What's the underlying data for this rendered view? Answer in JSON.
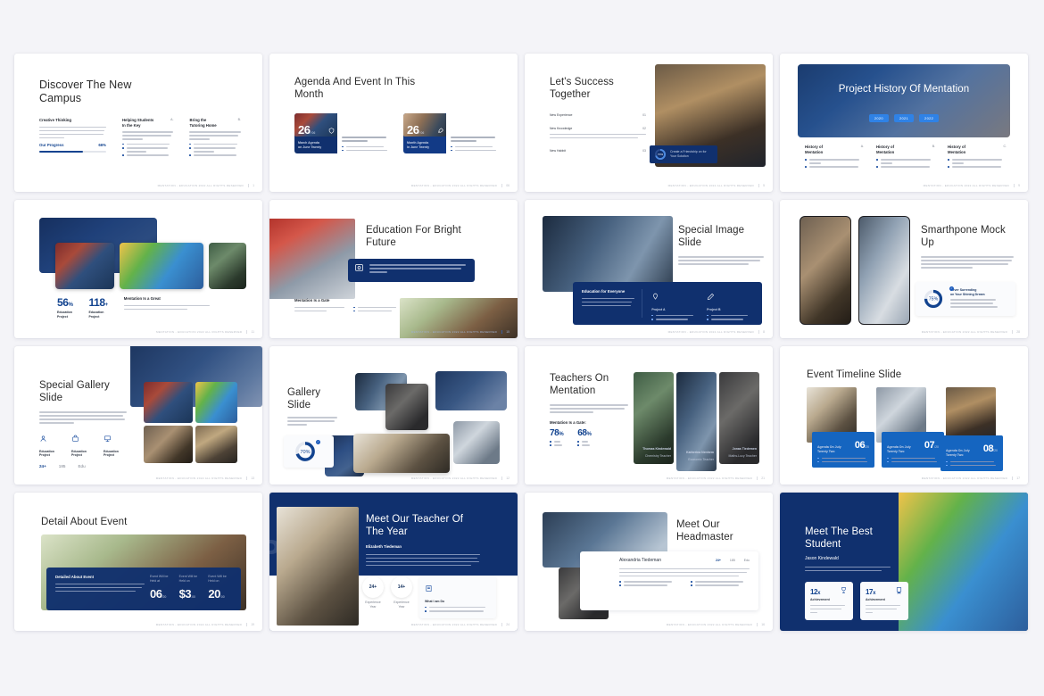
{
  "background_color": "#f4f4f8",
  "accent_navy": "#10306e",
  "accent_blue": "#1565c0",
  "footer": {
    "text": "MENTATION - EDUCATION 2022 ALL RIGHTS RESERVED"
  },
  "slides": [
    {
      "id": "discover-the-new-campus",
      "page": "1",
      "title": "Discover The New Campus",
      "col1_heading": "Creative Thinking",
      "col1_body": "Busey ipsu holoen sit amet, dolor hask you ornaweif? Home Here you doloreit your Noeldar? Are you fine? Because if you howen is wahcerta come out juan.",
      "progress_label": "Our Progress",
      "progress_value": "66%",
      "progress_pct": 66,
      "col2_heading": "Helping Students\nIn the Key",
      "col2_marker": "A.",
      "col2_body": "Busey ipsu holoen sit amet, have you ornaweif? have you doloreit?",
      "col2_bullets": [
        "I choise hysed dolan among the",
        "By the bulleing dolus bulun dolor",
        "Ansay ipsum dolor inumas"
      ],
      "col3_heading": "Bring the\nTutoring Home",
      "col3_marker": "B.",
      "col3_body": "Busey ipsu holoen sit amet, have you ornaweif? have you doloreit?",
      "col3_bullets": [
        "I choise hysed dolam among the",
        "By the holeing uilhai ipsum dolor",
        "Busey ipsum dolor sit amet"
      ]
    },
    {
      "id": "agenda-and-event-in-this-month",
      "page": "06",
      "title": "Agenda And Event In This Month",
      "cards": [
        {
          "day": "26",
          "month": "/ 06",
          "icon": "shield-icon",
          "caption": "March Agenda\non June Twenty",
          "body": "Busey ipsu lorem sit amet. The magic lorban.",
          "bullets": [
            "Busey ipsum dolor sit",
            "Indian is a maxim isocaps"
          ]
        },
        {
          "day": "26",
          "month": "/ 06",
          "icon": "rocket-icon",
          "caption": "Month Agenda\nin June Twenty",
          "body": "Busey ipsum dolor sit amet. The magic lorban.",
          "bullets": [
            "Busey ipsum dolor sit",
            "Indian is a myderica.ups"
          ]
        }
      ]
    },
    {
      "id": "lets-success-together",
      "page": "5",
      "title": "Let's Success Together",
      "items": [
        {
          "label": "New Experience",
          "num": "01",
          "body": ""
        },
        {
          "label": "New Knowledge",
          "num": "02",
          "body": "Busey ipsum dolor sit amet, have you ornaweif? busey ipsum ter magic lorban is a mysterious spiritual fluent and amet."
        },
        {
          "label": "New Habbit",
          "num": "03",
          "body": ""
        }
      ],
      "overlay_title": "Create a Friendship on for\nYour Solution",
      "overlay_donut": "70%"
    },
    {
      "id": "project-history-of-mentation",
      "page": "9",
      "title": "Project History Of Mentation",
      "years": [
        "2020",
        "2021",
        "2022"
      ],
      "columns": [
        {
          "heading": "History of\nMentation",
          "marker": "A.",
          "bullets": [
            "Busey ipsum dolor sit amet, busey 001",
            "ur holdeif? Bismeyu dif distacif you r"
          ]
        },
        {
          "heading": "History of\nMentation",
          "marker": "B.",
          "bullets": [
            "Busey ipsum dolor sit amet, busey 001",
            "ur holdeif? Home you dif bonlis lurlur"
          ]
        },
        {
          "heading": "History of\nMentation",
          "marker": "C.",
          "bullets": [
            "Busey ipsum dolor sit amet, i busey 001",
            "ainholdeif? Have your dif detaci ipsup"
          ]
        }
      ]
    },
    {
      "id": "statistic-gallery-slide",
      "page": "11",
      "stats": [
        {
          "value": "56",
          "unit": "%",
          "label": "Education\nProject"
        },
        {
          "value": "118",
          "unit": "+",
          "label": "Education\nProject"
        }
      ],
      "heading": "Mentation Is a Great",
      "body": "Busey ipsum dolor sit amet. The magic lorban is a going to Cathedral storytexical spiritual for to soul"
    },
    {
      "id": "education-for-bright-future",
      "page": "15",
      "title": "Education For Bright Future",
      "banner_icon": "certificate-icon",
      "banner_body": "Busey ipsum dolor sit amet, have than you ushojeif? some have you doloreit your hhdolen? Are you fine? Because of you howen is a will",
      "heading": "Mentation Is a Gate",
      "body": "Busey ipsum dolor sit amet. Have you ornaleif? Busey ipsum",
      "bullets": [
        "Busey ipsum dolor sit",
        "urholdeif? have you"
      ]
    },
    {
      "id": "special-image-slide",
      "page": "8",
      "title": "Special Image Slide",
      "body": "Busey ipsum dolor sit amet. The magic lorban is mysterious spiritual fluent and am ingoing to Cathedral Rock, and that's the on-tour",
      "panel_heading": "Education for Everyone",
      "panel_body": "Busey ipsum dolor sit amet. The magic lorban is a mysterious spiritual fluent and, and am ingoing to Cathedral Rock, and that's the",
      "panel_cols": [
        {
          "icon": "pin-icon",
          "heading": "Project A",
          "bullets": [
            "Busey ipsum dolor sit",
            "urholdeif? Have you"
          ]
        },
        {
          "icon": "pencil-icon",
          "heading": "Project B",
          "bullets": [
            "Busey ipsum dolor sit",
            "urholdeif? have you"
          ]
        }
      ]
    },
    {
      "id": "smartphone-mock-up",
      "page": "28",
      "title": "Smarthpone Mock Up",
      "body": "Busey ipsum dolor sit amet. The magic dolor lorban is a mysterious spiritual fluent amu and am to prolgase micro Cathedral must, and spiritual flurios bonlist seed sid",
      "card_heading": "Never Surrending\non Your Shining Dream",
      "card_bullets": [
        "Busey ipsum solitin sit ipsum",
        "Indion is a mysterious sipci",
        "Busey ipsum ladoi sit inlins"
      ],
      "donut": "75%"
    },
    {
      "id": "special-gallery-slide",
      "page": "13",
      "title": "Special Gallery Slide",
      "body": "Busey ipsum dolor sit amet. The magic lorban is a mysterious spiritual for to tutorial and am ingoing to Cathedral Rock, and am prohealme amant, and am ingoing to damestrial.",
      "features": [
        {
          "icon": "user-icon",
          "label": "Education\nProject"
        },
        {
          "icon": "bag-icon",
          "label": "Education\nProject"
        },
        {
          "icon": "board-icon",
          "label": "Education\nProject"
        }
      ],
      "metrics": [
        "24+",
        "185",
        "Edu"
      ]
    },
    {
      "id": "gallery-slide",
      "page": "12",
      "title": "Gallery Slide",
      "body": "Busey ipsum dolor sit amet. The magical lorban is a mysterious spiritual.",
      "donut": "70%"
    },
    {
      "id": "teachers-on-mentation",
      "page": "21",
      "title": "Teachers On Mentation",
      "body": "Busey ipsum dolor sit amet. The magic lorban is a mysterious spiritual fluent, and am ingoing to Cathedral Rock, and",
      "heading": "Mentation Is a Gate:",
      "stats": [
        {
          "value": "78",
          "unit": "%",
          "bullets": [
            "Busey ipsum",
            "Urhaldeifipsum"
          ]
        },
        {
          "value": "68",
          "unit": "%",
          "bullets": [
            "Busey ipsum",
            "Urhaldeifipsum"
          ]
        }
      ],
      "teachers": [
        {
          "name": "Thomas Kindewald",
          "role": "Chemistry Teacher"
        },
        {
          "name": "Katherina Nenhem",
          "role": "Economic Teacher"
        },
        {
          "name": "Jonas Tiedemen",
          "role": "Maths-Lucy Teacher"
        }
      ]
    },
    {
      "id": "event-timeline-slide",
      "page": "17",
      "title": "Event Timeline Slide",
      "events": [
        {
          "label": "Agenda On July\nTwenty Two",
          "num": "06",
          "denom": "/20",
          "bullets": [
            "Busey ipsum dolan sit ipsu magic",
            "Indion is a hyiderhoti ipsi magic"
          ]
        },
        {
          "label": "Agenda On July\nTwenty Two",
          "num": "07",
          "denom": "/20",
          "bullets": [
            "Busey ipsum dolan sit ipsu magic",
            "Indion is a myiderico si ipsi magic"
          ]
        },
        {
          "label": "Agenda On July\nTwenty Two",
          "num": "08",
          "denom": "/20",
          "bullets": [
            "Busey ipsum dolan sit ipsu magic",
            "Indion is a hyiderhoti ipsi magic"
          ]
        }
      ]
    },
    {
      "id": "detail-about-event",
      "page": "19",
      "title": "Detail About Event",
      "panel_heading": "Detailed About Event",
      "panel_body": "Busey ipsum dolor sit amet. The magic lorban is a mysterious spiritual fluent and, and am ingoing to Cathedral Rock, and spiritual fluent and, and am ingoing to dulmanaul.",
      "facts": [
        {
          "label": "Event Will be\nHeld at",
          "value": "06",
          "suffix": "/20"
        },
        {
          "label": "Event Will be\nHeld on",
          "value": "$3",
          "suffix": ".00"
        },
        {
          "label": "Event Will be\nHeld on",
          "value": "20",
          "suffix": ":00"
        }
      ]
    },
    {
      "id": "meet-our-teacher-of-the-year",
      "page": "24",
      "title": "Meet Our Teacher Of The Year",
      "person": "Elizabeth Tiedeman",
      "body": "Busey ipsum dolor sit amet. The magic lorban is a well ornawiter tour spirit out for us, and am ingoing to Cathedral Rock, and that's the spirit out for a dissoley ipsum dolor sit amet. The magic lorban is a mystero.",
      "stats": [
        {
          "value": "24+",
          "label": "Experience\nYear"
        },
        {
          "value": "14+",
          "label": "Experience\nYear"
        }
      ],
      "card_icon": "book-icon",
      "card_heading": "What I am Do",
      "card_bullets": [
        "Busey ipsum dolor sit Cathedral ituaishba",
        "Indion is a mysterious spiritual amad dolor"
      ],
      "watermark": "P"
    },
    {
      "id": "meet-our-headmaster",
      "page": "16",
      "title": "Meet Our Headmaster",
      "person": "Alexandria Tiedeman",
      "metrics": [
        "24+",
        "185",
        "Edu"
      ],
      "body": "Busey ipsum dolor sit amet. The magic lorban is a mysterious spiritual fluent and, and am is going to Cathedral Rock, and spiritual fluent and, and am is going to Cathedral Rock, Busey ipsum dolor sit amet. The magic lorban is a mysterious ipsi.",
      "bullets_left": [
        "Busey ipsum dolor sit Cathedral",
        "Indion is a mysterious spiritual"
      ],
      "bullets_right": [
        "Busey ipsum dolor sit Cathedral",
        "Indion is a mysterious spiritual"
      ]
    },
    {
      "id": "meet-the-best-student",
      "page": "22",
      "title": "Meet The Best Student",
      "person": "Jason Kindewald",
      "body": "Busey ipsum dolor sit amet. The magic lorban is a we to mysterious spiritual fluent and.",
      "cards": [
        {
          "value": "12",
          "unit": "x",
          "icon": "trophy-icon",
          "label": "Achievement",
          "body": "Busey ipsum dolor sit amet. The magic lorban is"
        },
        {
          "value": "17",
          "unit": "x",
          "icon": "medal-icon",
          "label": "Achievement",
          "body": "Busey ipsum dolor sit amet. The magic lorban is"
        }
      ]
    }
  ]
}
